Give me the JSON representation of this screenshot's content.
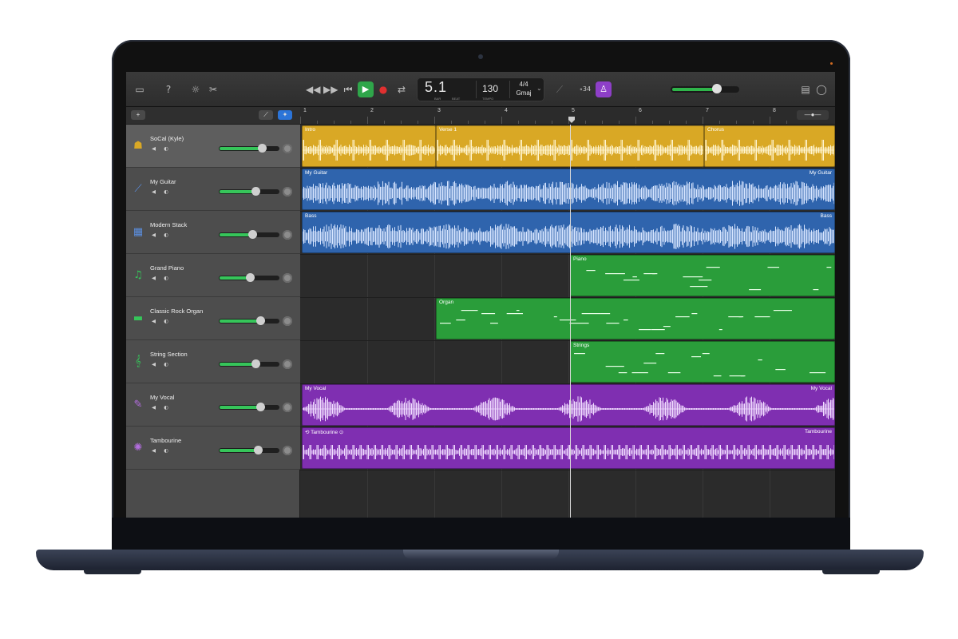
{
  "transport": {
    "rewind_icon": "rewind-icon",
    "forward_icon": "fast-forward-icon",
    "to_start_icon": "skip-to-start-icon",
    "play_icon": "play-icon",
    "record_icon": "record-icon",
    "cycle_icon": "cycle-icon"
  },
  "lcd": {
    "position": "5.1",
    "bar_label": "BAR",
    "beat_label": "BEAT",
    "tempo": "130",
    "tempo_label": "TEMPO",
    "time_signature": "4/4",
    "key": "Gmaj"
  },
  "count_in": "⃘34",
  "colors": {
    "play": "#2fa64a",
    "record": "#e03030",
    "tuner": "#8e3fc8",
    "drummer": "#d9a825",
    "audio_blue": "#2f64ad",
    "software_green": "#2a9d3a",
    "vocal_purple": "#7f2fb1"
  },
  "master_volume": 0.68,
  "ruler": {
    "bars": [
      "1",
      "2",
      "3",
      "4",
      "5",
      "6",
      "7",
      "8"
    ]
  },
  "tracks": [
    {
      "name": "SoCal (Kyle)",
      "icon": "drummer-icon",
      "volume": 0.72,
      "selected": true
    },
    {
      "name": "My Guitar",
      "icon": "guitar-icon",
      "volume": 0.62
    },
    {
      "name": "Modern Stack",
      "icon": "amp-icon",
      "volume": 0.56
    },
    {
      "name": "Grand Piano",
      "icon": "piano-icon",
      "volume": 0.52
    },
    {
      "name": "Classic Rock Organ",
      "icon": "organ-icon",
      "volume": 0.7
    },
    {
      "name": "String Section",
      "icon": "strings-icon",
      "volume": 0.62
    },
    {
      "name": "My Vocal",
      "icon": "microphone-icon",
      "volume": 0.7
    },
    {
      "name": "Tambourine",
      "icon": "tambourine-icon",
      "volume": 0.66
    }
  ],
  "regions": {
    "intro": "Intro",
    "verse": "Verse 1",
    "chorus": "Chorus",
    "guitar": "My Guitar",
    "bass": "Bass",
    "piano": "Piano",
    "organ": "Organ",
    "strings": "Strings",
    "vocal": "My Vocal",
    "tambourine": "Tambourine"
  }
}
